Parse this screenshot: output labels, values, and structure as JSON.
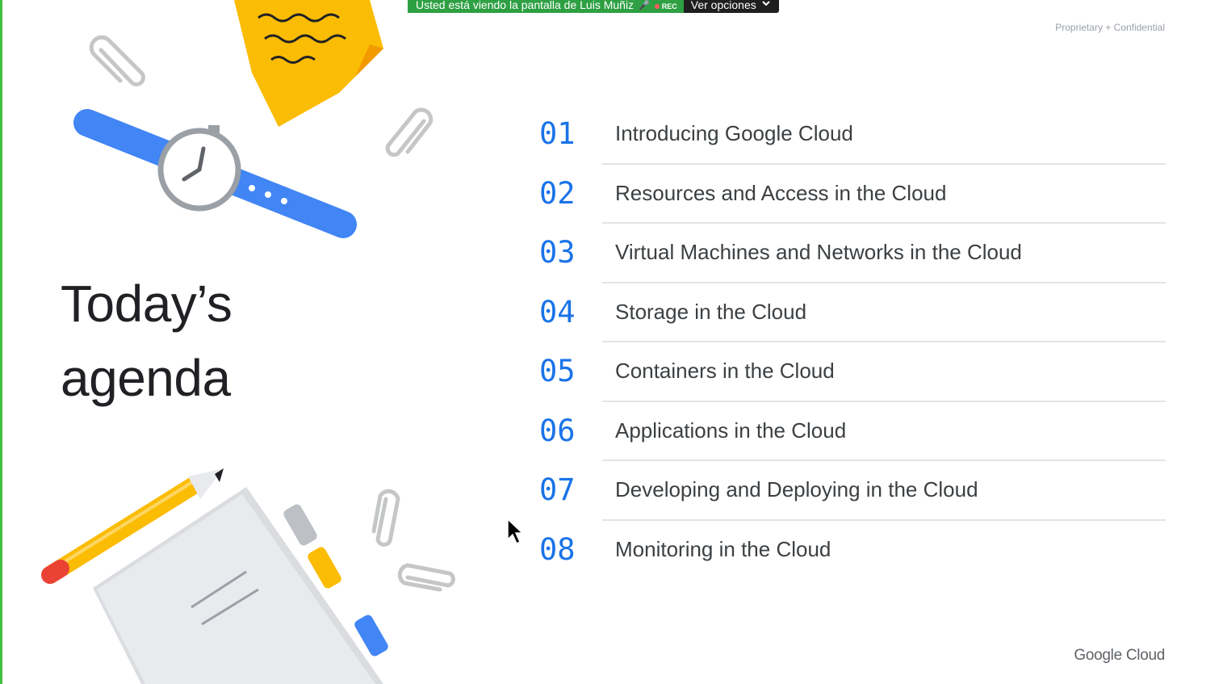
{
  "share_bar": {
    "message": "Usted está viendo la pantalla de Luis Muñiz",
    "rec_label": "REC",
    "options_label": "Ver opciones"
  },
  "slide": {
    "confidential_label": "Proprietary + Confidential",
    "title_line1": "Today’s",
    "title_line2": "agenda",
    "items": [
      {
        "number": "01",
        "label": "Introducing Google Cloud"
      },
      {
        "number": "02",
        "label": "Resources and Access in the Cloud"
      },
      {
        "number": "03",
        "label": "Virtual Machines and Networks in the Cloud"
      },
      {
        "number": "04",
        "label": "Storage in the Cloud"
      },
      {
        "number": "05",
        "label": "Containers in the Cloud"
      },
      {
        "number": "06",
        "label": "Applications in the Cloud"
      },
      {
        "number": "07",
        "label": "Developing and Deploying in the Cloud"
      },
      {
        "number": "08",
        "label": "Monitoring in the Cloud"
      }
    ],
    "footer_logo": "Google Cloud"
  },
  "colors": {
    "accent_blue": "#1a73e8",
    "share_green": "#2ea043",
    "sticky_yellow": "#fbbc04",
    "watch_blue": "#4285f4",
    "pencil_red": "#ea4335"
  }
}
